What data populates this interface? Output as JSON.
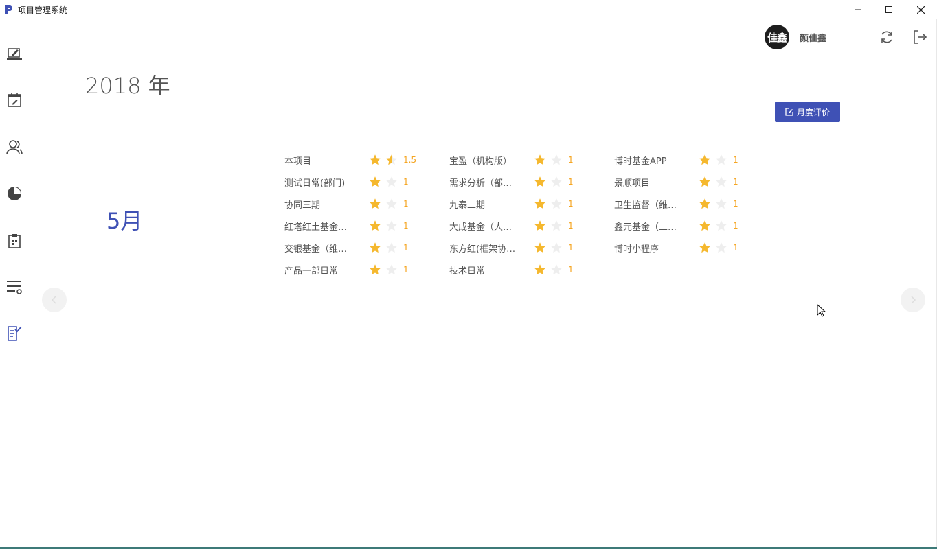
{
  "window": {
    "title": "项目管理系统"
  },
  "sidebar": {
    "items": [
      {
        "icon": "edit-board-icon"
      },
      {
        "icon": "calendar-edit-icon"
      },
      {
        "icon": "users-icon"
      },
      {
        "icon": "pie-chart-icon"
      },
      {
        "icon": "clipboard-icon"
      },
      {
        "icon": "list-settings-icon"
      },
      {
        "icon": "checklist-icon",
        "active": true
      }
    ]
  },
  "user": {
    "avatar_text": "佳鑫",
    "name": "颜佳鑫"
  },
  "page": {
    "year": "2018 年",
    "month": "5月",
    "evaluate_button": "月度评价"
  },
  "projects": [
    {
      "name": "本项目",
      "rating": 1.5,
      "score": "1.5"
    },
    {
      "name": "宝盈（机构版）",
      "rating": 1,
      "score": "1"
    },
    {
      "name": "博时基金APP",
      "rating": 1,
      "score": "1"
    },
    {
      "name": "测试日常(部门)",
      "rating": 1,
      "score": "1"
    },
    {
      "name": "需求分析（部…",
      "rating": 1,
      "score": "1"
    },
    {
      "name": "景顺项目",
      "rating": 1,
      "score": "1"
    },
    {
      "name": "协同三期",
      "rating": 1,
      "score": "1"
    },
    {
      "name": "九泰二期",
      "rating": 1,
      "score": "1"
    },
    {
      "name": "卫生监督（维…",
      "rating": 1,
      "score": "1"
    },
    {
      "name": "红塔红土基金…",
      "rating": 1,
      "score": "1"
    },
    {
      "name": "大成基金（人…",
      "rating": 1,
      "score": "1"
    },
    {
      "name": "鑫元基金（二…",
      "rating": 1,
      "score": "1"
    },
    {
      "name": "交银基金（维…",
      "rating": 1,
      "score": "1"
    },
    {
      "name": "东方红(框架协…",
      "rating": 1,
      "score": "1"
    },
    {
      "name": "博时小程序",
      "rating": 1,
      "score": "1"
    },
    {
      "name": "产品一部日常",
      "rating": 1,
      "score": "1"
    },
    {
      "name": "技术日常",
      "rating": 1,
      "score": "1"
    }
  ],
  "colors": {
    "accent": "#3f51b5",
    "star": "#f5b82e",
    "star_empty": "#eeeeee"
  }
}
